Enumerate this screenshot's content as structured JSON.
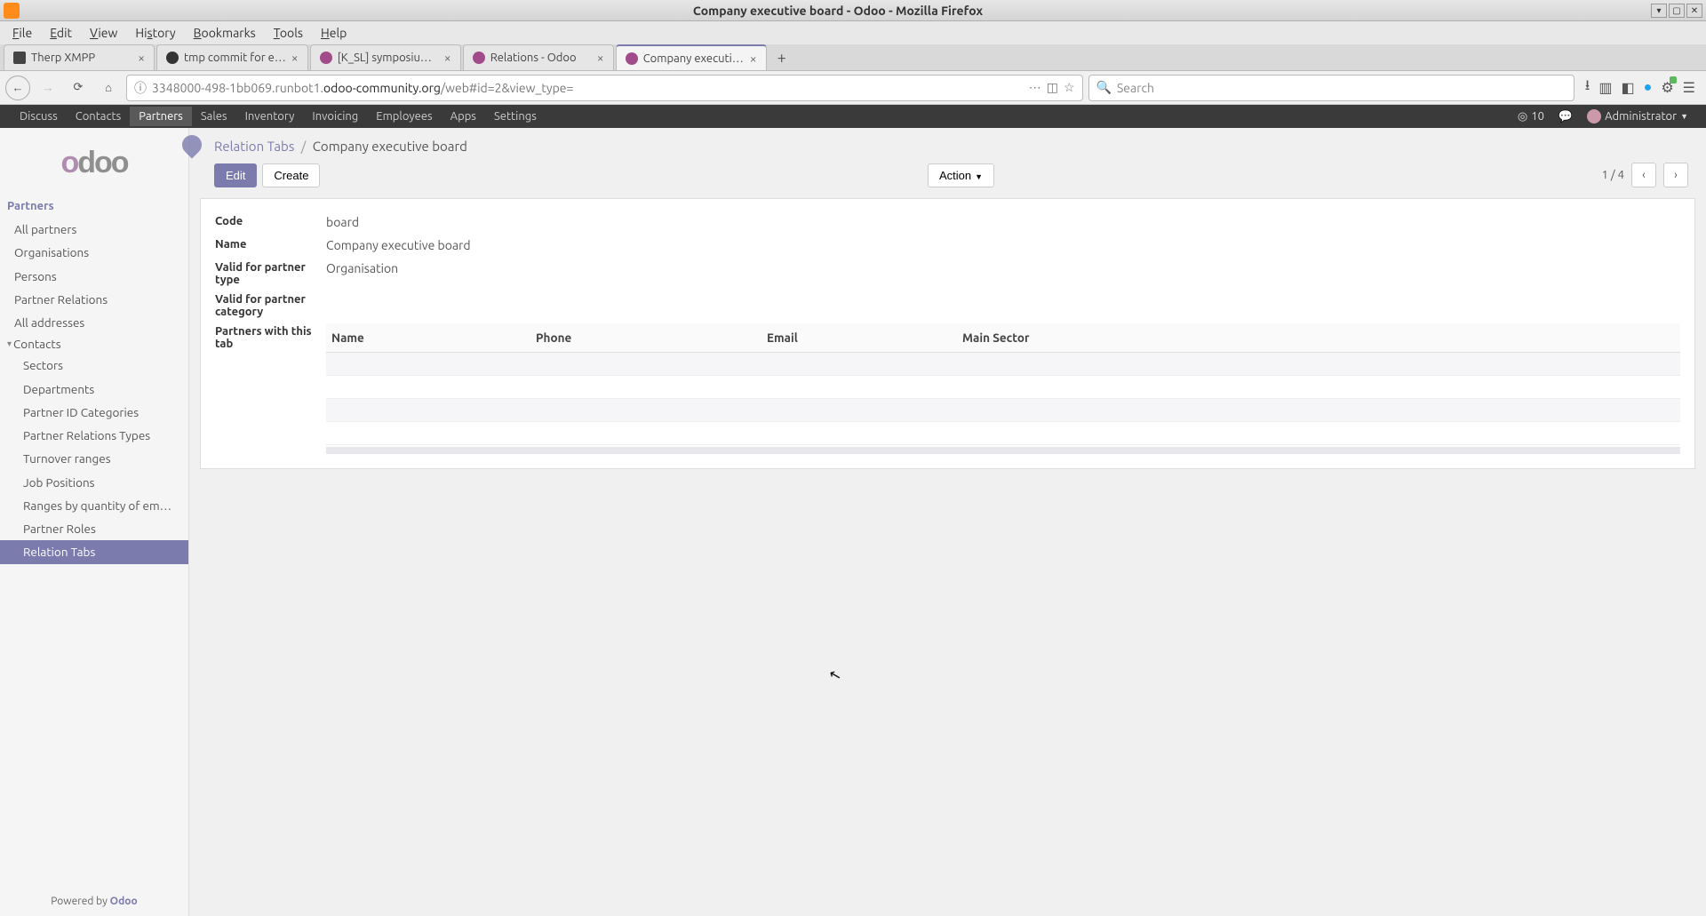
{
  "window": {
    "title": "Company executive board - Odoo - Mozilla Firefox"
  },
  "menubar": {
    "file": "File",
    "edit": "Edit",
    "view": "View",
    "history": "History",
    "bookmarks": "Bookmarks",
    "tools": "Tools",
    "help": "Help"
  },
  "tabs": [
    {
      "label": "Therp XMPP",
      "favicon": "#444"
    },
    {
      "label": "tmp commit for e…",
      "favicon": "#333"
    },
    {
      "label": "[K_SL] symposiu…",
      "favicon": "#a24b8b"
    },
    {
      "label": "Relations - Odoo",
      "favicon": "#a24b8b"
    },
    {
      "label": "Company executi…",
      "favicon": "#a24b8b",
      "active": true
    }
  ],
  "url": {
    "prefix": "3348000-498-1bb069.runbot1.",
    "host": "odoo-community.org",
    "path": "/web#id=2&view_type="
  },
  "search_placeholder": "Search",
  "odoo_nav": {
    "items": [
      "Discuss",
      "Contacts",
      "Partners",
      "Sales",
      "Inventory",
      "Invoicing",
      "Employees",
      "Apps",
      "Settings"
    ],
    "active_index": 2,
    "notif_count": "10",
    "user": "Administrator"
  },
  "sidebar": {
    "group": "Partners",
    "items": [
      "All partners",
      "Organisations",
      "Persons",
      "Partner Relations",
      "All addresses"
    ],
    "contacts_label": "Contacts",
    "contacts_items": [
      "Sectors",
      "Departments",
      "Partner ID Categories",
      "Partner Relations Types",
      "Turnover ranges",
      "Job Positions",
      "Ranges by quantity of em…",
      "Partner Roles",
      "Relation Tabs"
    ],
    "active": "Relation Tabs",
    "powered_prefix": "Powered by ",
    "powered_brand": "Odoo"
  },
  "breadcrumb": {
    "parent": "Relation Tabs",
    "current": "Company executive board"
  },
  "buttons": {
    "edit": "Edit",
    "create": "Create",
    "action": "Action"
  },
  "pager": {
    "position": "1 / 4"
  },
  "form": {
    "fields": [
      {
        "label": "Code",
        "value": "board"
      },
      {
        "label": "Name",
        "value": "Company executive board"
      },
      {
        "label": "Valid for partner type",
        "value": "Organisation"
      },
      {
        "label": "Valid for partner category",
        "value": ""
      }
    ],
    "table_label": "Partners with this tab",
    "columns": [
      "Name",
      "Phone",
      "Email",
      "Main Sector"
    ]
  },
  "logo_text": "odoo"
}
